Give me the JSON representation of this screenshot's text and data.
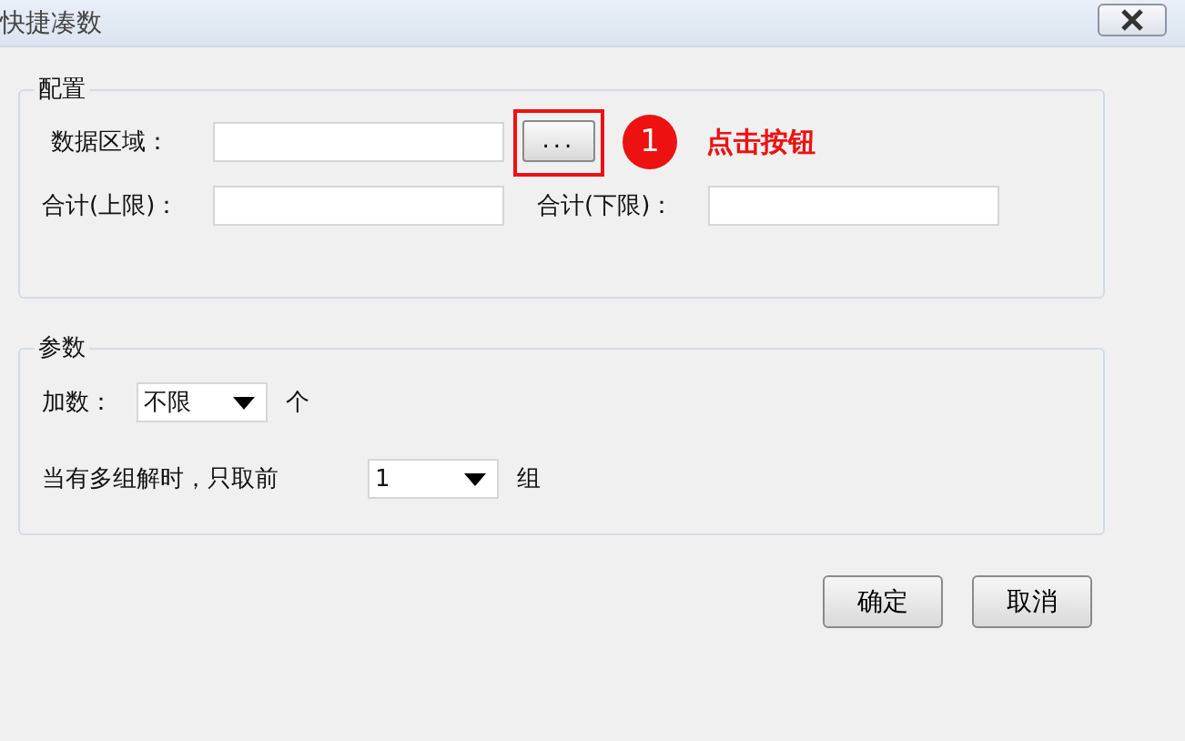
{
  "window": {
    "title": "快捷凑数"
  },
  "config_group": {
    "title": "配置",
    "data_range": {
      "label": "数据区域：",
      "browse_button": "...",
      "annotation": {
        "number": "1",
        "text": "点击按钮"
      }
    },
    "sum_max": {
      "label": "合计(上限)："
    },
    "sum_min": {
      "label": "合计(下限)："
    }
  },
  "params_group": {
    "title": "参数",
    "addends": {
      "label": "加数：",
      "value": "不限",
      "unit": "个"
    },
    "solutions": {
      "label": "当有多组解时，只取前",
      "value": "1",
      "unit": "组"
    }
  },
  "buttons": [
    "确定",
    "取消"
  ]
}
